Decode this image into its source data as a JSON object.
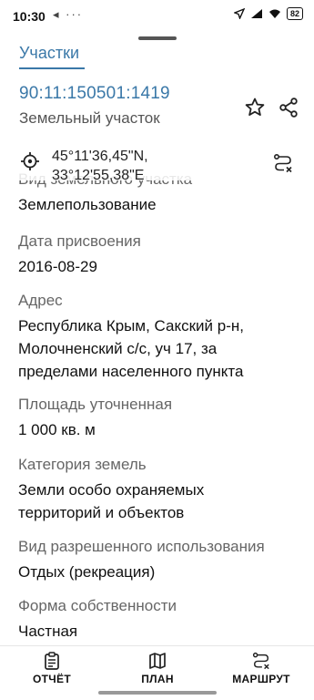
{
  "status_bar": {
    "time": "10:30",
    "left_icons": "◂ ···",
    "battery": "82"
  },
  "tabs": {
    "active": "Участки"
  },
  "parcel": {
    "cadastral_number": "90:11:150501:1419",
    "type": "Земельный участок",
    "coordinates_lat": "45°11'36,45\"N,",
    "coordinates_lon": "33°12'55,38\"E"
  },
  "fields": [
    {
      "label": "Вид земельного участка",
      "value": "Землепользование"
    },
    {
      "label": "Дата присвоения",
      "value": "2016-08-29"
    },
    {
      "label": "Адрес",
      "value": "Республика Крым, Сакский р-н, Молочненский с/с, уч 17, за пределами населенного пункта"
    },
    {
      "label": "Площадь уточненная",
      "value": "1 000 кв. м"
    },
    {
      "label": "Категория земель",
      "value": "Земли особо охраняемых территорий и объектов"
    },
    {
      "label": "Вид разрешенного использования",
      "value": "Отдых (рекреация)"
    },
    {
      "label": "Форма собственности",
      "value": "Частная"
    }
  ],
  "bottom_nav": [
    {
      "label": "ОТЧЁТ",
      "icon": "report-icon"
    },
    {
      "label": "ПЛАН",
      "icon": "map-icon"
    },
    {
      "label": "МАРШРУТ",
      "icon": "route-icon"
    }
  ],
  "colors": {
    "accent": "#3a78a8"
  }
}
